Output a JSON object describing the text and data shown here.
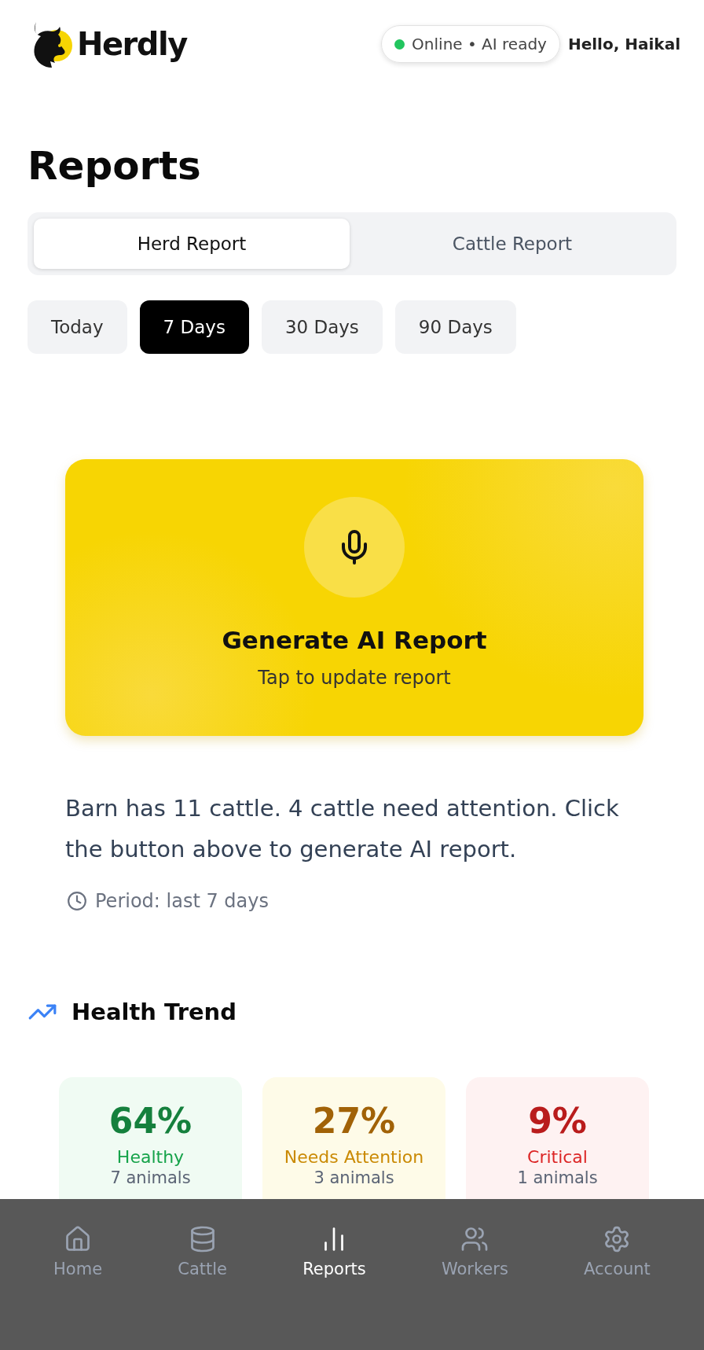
{
  "header": {
    "brand": "Herdly",
    "status": {
      "online": true,
      "label": "Online • AI ready"
    },
    "greeting": "Hello, Haikal"
  },
  "page_title": "Reports",
  "tabs": [
    {
      "label": "Herd Report",
      "selected": true
    },
    {
      "label": "Cattle Report",
      "selected": false
    }
  ],
  "periods": [
    {
      "label": "Today",
      "selected": false
    },
    {
      "label": "7 Days",
      "selected": true
    },
    {
      "label": "30 Days",
      "selected": false
    },
    {
      "label": "90 Days",
      "selected": false
    }
  ],
  "ai_card": {
    "title": "Generate AI Report",
    "subtitle": "Tap to update report"
  },
  "summary": "Barn has 11 cattle. 4 cattle need attention. Click the button above to generate AI report.",
  "period_note": "Period: last 7 days",
  "health_trend": {
    "title": "Health Trend",
    "stats": [
      {
        "kind": "healthy",
        "percent": "64%",
        "label": "Healthy",
        "count": "7 animals"
      },
      {
        "kind": "attention",
        "percent": "27%",
        "label": "Needs Attention",
        "count": "3 animals"
      },
      {
        "kind": "critical",
        "percent": "9%",
        "label": "Critical",
        "count": "1 animals"
      }
    ]
  },
  "bottom_nav": [
    {
      "label": "Home",
      "selected": false
    },
    {
      "label": "Cattle",
      "selected": false
    },
    {
      "label": "Reports",
      "selected": true
    },
    {
      "label": "Workers",
      "selected": false
    },
    {
      "label": "Account",
      "selected": false
    }
  ]
}
